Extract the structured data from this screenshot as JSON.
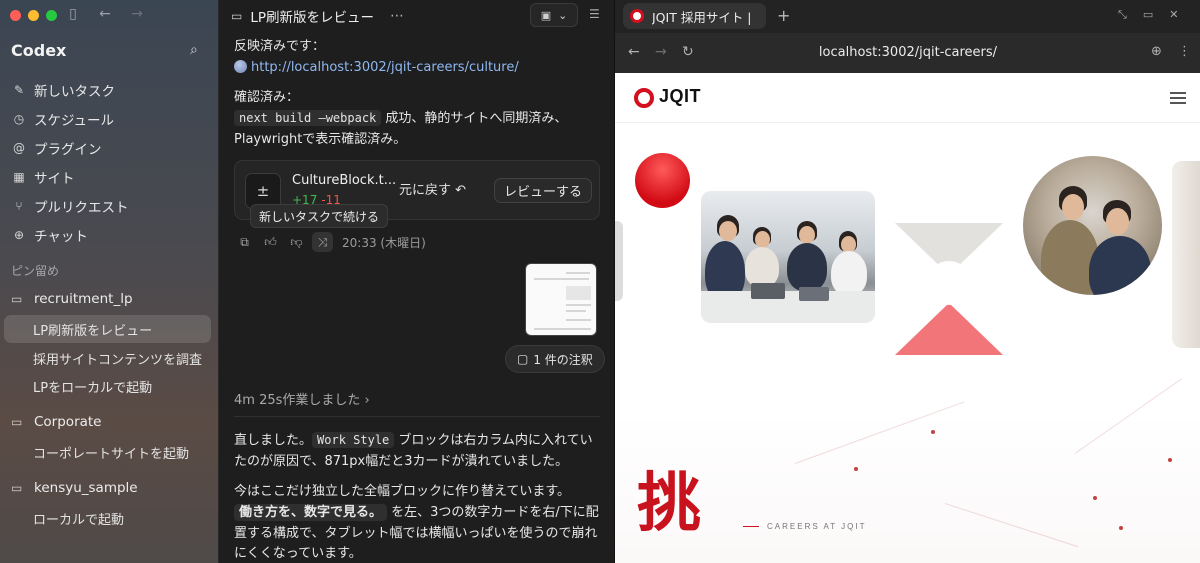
{
  "sidebar": {
    "app_title": "Codex",
    "nav": [
      {
        "label": "新しいタスク",
        "icon": "edit-icon"
      },
      {
        "label": "スケジュール",
        "icon": "clock-icon"
      },
      {
        "label": "プラグイン",
        "icon": "plugin-icon"
      },
      {
        "label": "サイト",
        "icon": "grid-icon"
      },
      {
        "label": "プルリクエスト",
        "icon": "pull-request-icon"
      },
      {
        "label": "チャット",
        "icon": "chat-plus-icon"
      }
    ],
    "pinned_label": "ピン留め",
    "groups": [
      {
        "name": "recruitment_lp",
        "threads": [
          "LP刷新版をレビュー",
          "採用サイトコンテンツを調査",
          "LPをローカルで起動"
        ]
      },
      {
        "name": "Corporate",
        "threads": [
          "コーポレートサイトを起動"
        ]
      },
      {
        "name": "kensyu_sample",
        "threads": [
          "ローカルで起動"
        ]
      }
    ]
  },
  "chat": {
    "title": "LP刷新版をレビュー",
    "reflected_label": "反映済みです：",
    "reflected_url": "http://localhost:3002/jqit-careers/culture/",
    "confirmed_label": "確認済み：",
    "confirmed_code": "next build —webpack",
    "confirmed_rest": "成功、静的サイトへ同期済み、",
    "confirmed_line2": "Playwrightで表示確認済み。",
    "file": {
      "name": "CultureBlock.t...",
      "additions": "+17",
      "deletions": "-11"
    },
    "undo_label": "元に戻す",
    "review_label": "レビューする",
    "tooltip": "新しいタスクで続ける",
    "timestamp": "20:33 (木曜日)",
    "notes_label": "1 件の注釈",
    "worked_label": "4m 25s作業しました",
    "p1_a": "直しました。",
    "p1_code": "Work Style",
    "p1_b": "ブロックは右カラム内に入れてい",
    "p1_line2": "たのが原因で、871px幅だと3カードが潰れていました。",
    "p2_line1": "今はここだけ独立した全幅ブロックに作り替えています。",
    "p2_code": "働き方を、数字で見る。",
    "p2_rest": "を左、3つの数字カードを右/下に配",
    "p2_line3": "置する構成で、タブレット幅では横幅いっぱいを使うので崩れ",
    "p2_line4": "にくくなっています。"
  },
  "browser": {
    "tab_title": "JQIT 採用サイト |",
    "url": "localhost:3002/jqit-careers/",
    "logo_text": "JQIT",
    "hero_kanji": "挑",
    "careers_tag": "CAREERS AT JQIT",
    "accent": "#d40f1e"
  }
}
